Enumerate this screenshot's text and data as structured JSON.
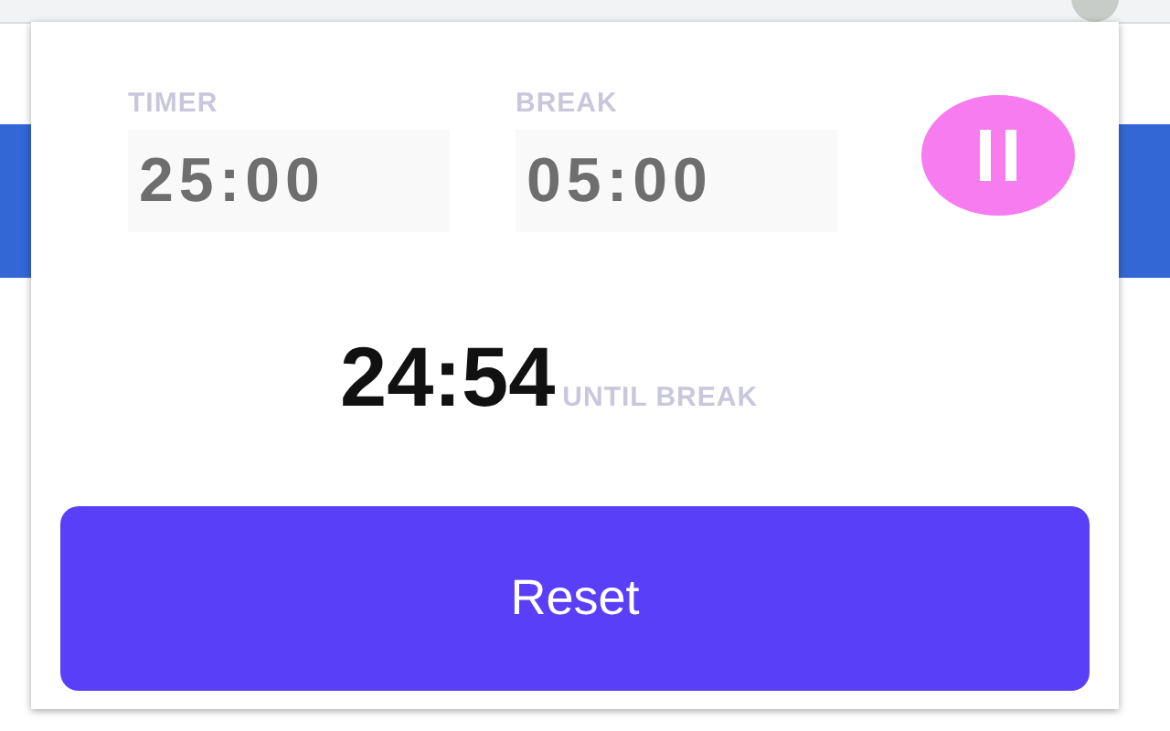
{
  "timer": {
    "label": "TIMER",
    "value": "25:00"
  },
  "break": {
    "label": "BREAK",
    "value": "05:00"
  },
  "pause_button": {
    "kind": "pause"
  },
  "countdown": {
    "value": "24:54",
    "caption": "UNTIL BREAK"
  },
  "reset_button": {
    "label": "Reset"
  }
}
